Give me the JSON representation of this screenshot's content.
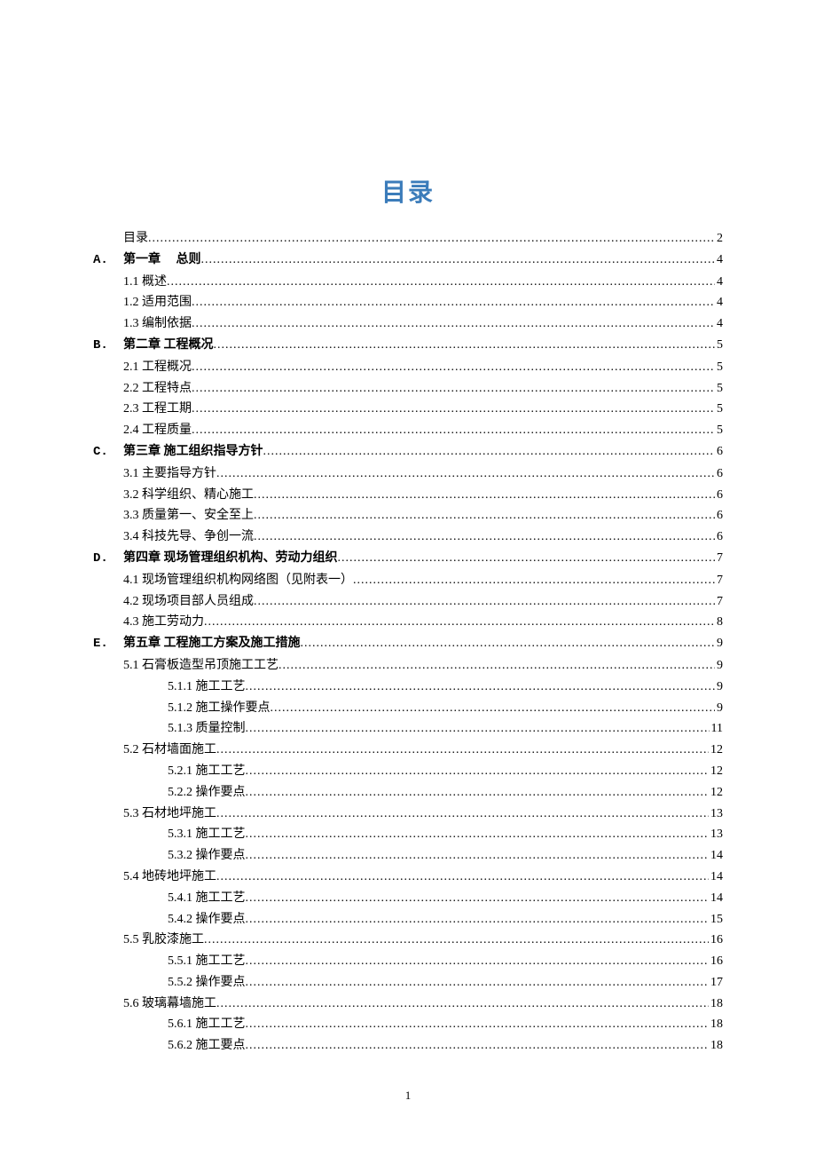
{
  "title": "目录",
  "page_number": "1",
  "toc": [
    {
      "marker": "",
      "indent": 0,
      "label": "目录",
      "bold": false,
      "page": "2"
    },
    {
      "marker": "A.",
      "indent": 0,
      "label": "第一章　 总则",
      "bold": true,
      "page": "4"
    },
    {
      "marker": "",
      "indent": 1,
      "label": "1.1 概述",
      "bold": false,
      "page": "4"
    },
    {
      "marker": "",
      "indent": 1,
      "label": "1.2 适用范围",
      "bold": false,
      "page": "4"
    },
    {
      "marker": "",
      "indent": 1,
      "label": "1.3 编制依据",
      "bold": false,
      "page": "4"
    },
    {
      "marker": "B.",
      "indent": 0,
      "label": "第二章  工程概况 ",
      "bold": true,
      "page": "5"
    },
    {
      "marker": "",
      "indent": 1,
      "label": "2.1 工程概况",
      "bold": false,
      "page": "5"
    },
    {
      "marker": "",
      "indent": 1,
      "label": "2.2 工程特点",
      "bold": false,
      "page": "5"
    },
    {
      "marker": "",
      "indent": 1,
      "label": "2.3 工程工期",
      "bold": false,
      "page": "5"
    },
    {
      "marker": "",
      "indent": 1,
      "label": "2.4 工程质量",
      "bold": false,
      "page": "5"
    },
    {
      "marker": "C.",
      "indent": 0,
      "label": "第三章  施工组织指导方针 ",
      "bold": true,
      "page": "6"
    },
    {
      "marker": "",
      "indent": 1,
      "label": "3.1 主要指导方针",
      "bold": false,
      "page": "6"
    },
    {
      "marker": "",
      "indent": 1,
      "label": "3.2 科学组织、精心施工",
      "bold": false,
      "page": "6"
    },
    {
      "marker": "",
      "indent": 1,
      "label": "3.3 质量第一、安全至上",
      "bold": false,
      "page": "6"
    },
    {
      "marker": "",
      "indent": 1,
      "label": "3.4 科技先导、争创一流",
      "bold": false,
      "page": "6"
    },
    {
      "marker": "D.",
      "indent": 0,
      "label": "第四章  现场管理组织机构、劳动力组织 ",
      "bold": true,
      "page": "7"
    },
    {
      "marker": "",
      "indent": 1,
      "label": "4.1 现场管理组织机构网络图（见附表一）",
      "bold": false,
      "page": "7"
    },
    {
      "marker": "",
      "indent": 1,
      "label": "4.2 现场项目部人员组成",
      "bold": false,
      "page": "7"
    },
    {
      "marker": "",
      "indent": 1,
      "label": "4.3 施工劳动力",
      "bold": false,
      "page": "8"
    },
    {
      "marker": "E.",
      "indent": 0,
      "label": "第五章 工程施工方案及施工措施 ",
      "bold": true,
      "page": "9"
    },
    {
      "marker": "",
      "indent": 1,
      "label": "5.1 石膏板造型吊顶施工工艺",
      "bold": false,
      "page": "9"
    },
    {
      "marker": "",
      "indent": 2,
      "label": "5.1.1 施工工艺",
      "bold": false,
      "page": "9"
    },
    {
      "marker": "",
      "indent": 2,
      "label": "5.1.2 施工操作要点  ",
      "bold": false,
      "page": "9"
    },
    {
      "marker": "",
      "indent": 2,
      "label": "5.1.3 质量控制",
      "bold": false,
      "page": "11"
    },
    {
      "marker": "",
      "indent": 1,
      "label": "5.2 石材墙面施工",
      "bold": false,
      "page": "12"
    },
    {
      "marker": "",
      "indent": 2,
      "label": "5.2.1 施工工艺",
      "bold": false,
      "page": "12"
    },
    {
      "marker": "",
      "indent": 2,
      "label": "5.2.2 操作要点",
      "bold": false,
      "page": "12"
    },
    {
      "marker": "",
      "indent": 1,
      "label": "5.3 石材地坪施工",
      "bold": false,
      "page": "13"
    },
    {
      "marker": "",
      "indent": 2,
      "label": "5.3.1 施工工艺",
      "bold": false,
      "page": "13"
    },
    {
      "marker": "",
      "indent": 2,
      "label": "5.3.2 操作要点",
      "bold": false,
      "page": "14"
    },
    {
      "marker": "",
      "indent": 1,
      "label": "5.4 地砖地坪施工",
      "bold": false,
      "page": "14"
    },
    {
      "marker": "",
      "indent": 2,
      "label": "5.4.1 施工工艺",
      "bold": false,
      "page": "14"
    },
    {
      "marker": "",
      "indent": 2,
      "label": "5.4.2 操作要点",
      "bold": false,
      "page": "15"
    },
    {
      "marker": "",
      "indent": 1,
      "label": "5.5 乳胶漆施工",
      "bold": false,
      "page": "16"
    },
    {
      "marker": "",
      "indent": 2,
      "label": "5.5.1 施工工艺",
      "bold": false,
      "page": "16"
    },
    {
      "marker": "",
      "indent": 2,
      "label": "5.5.2 操作要点",
      "bold": false,
      "page": "17"
    },
    {
      "marker": "",
      "indent": 1,
      "label": "5.6 玻璃幕墙施工",
      "bold": false,
      "page": "18"
    },
    {
      "marker": "",
      "indent": 2,
      "label": "5.6.1 施工工艺",
      "bold": false,
      "page": "18"
    },
    {
      "marker": "",
      "indent": 2,
      "label": "5.6.2 施工要点",
      "bold": false,
      "page": "18"
    }
  ]
}
